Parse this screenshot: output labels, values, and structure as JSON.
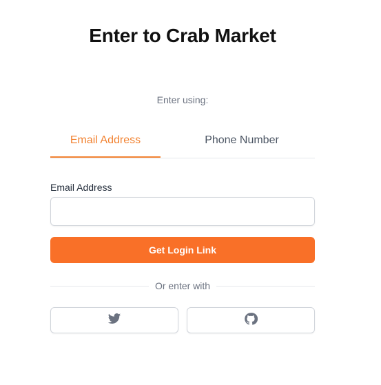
{
  "title": "Enter to Crab Market",
  "enter_using": "Enter using:",
  "tabs": [
    {
      "label": "Email Address",
      "active": true
    },
    {
      "label": "Phone Number",
      "active": false
    }
  ],
  "email_field": {
    "label": "Email Address",
    "value": "",
    "placeholder": ""
  },
  "login_button_label": "Get Login Link",
  "divider_text": "Or enter with",
  "social": [
    {
      "icon": "twitter-icon"
    },
    {
      "icon": "github-icon"
    }
  ],
  "colors": {
    "accent": "#f97028",
    "active_tab": "#f28332"
  }
}
